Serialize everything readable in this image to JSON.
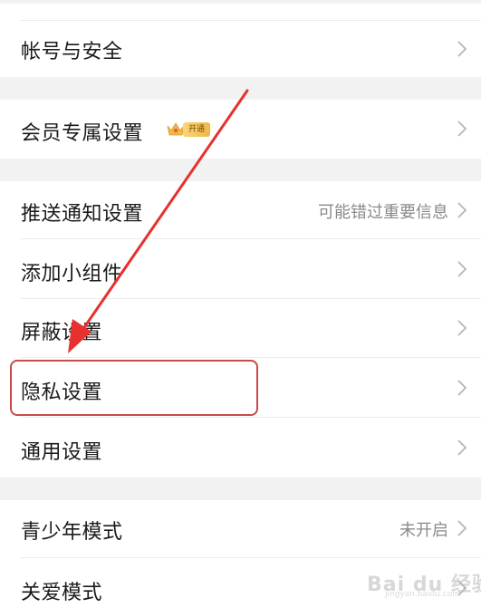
{
  "settings": {
    "account_security": "帐号与安全",
    "vip_settings": "会员专属设置",
    "vip_badge": "开通",
    "push_notifications": "推送通知设置",
    "push_notifications_hint": "可能错过重要信息",
    "add_widget": "添加小组件",
    "block_settings": "屏蔽设置",
    "privacy_settings": "隐私设置",
    "general_settings": "通用设置",
    "teen_mode": "青少年模式",
    "teen_mode_status": "未开启",
    "care_mode": "关爱模式"
  },
  "icons": {
    "chevron": "chevron-right-icon",
    "vip_crown": "crown-icon",
    "annotation_arrow": "red-arrow-annotation"
  },
  "colors": {
    "annotation_red": "#e8302f",
    "highlight_border": "#c94a4a",
    "section_gap": "#f2f2f2",
    "vip_gold": "#f0b84a"
  },
  "watermark": {
    "brand": "Bai du 经验",
    "url": "jingyan.baidu.com"
  }
}
